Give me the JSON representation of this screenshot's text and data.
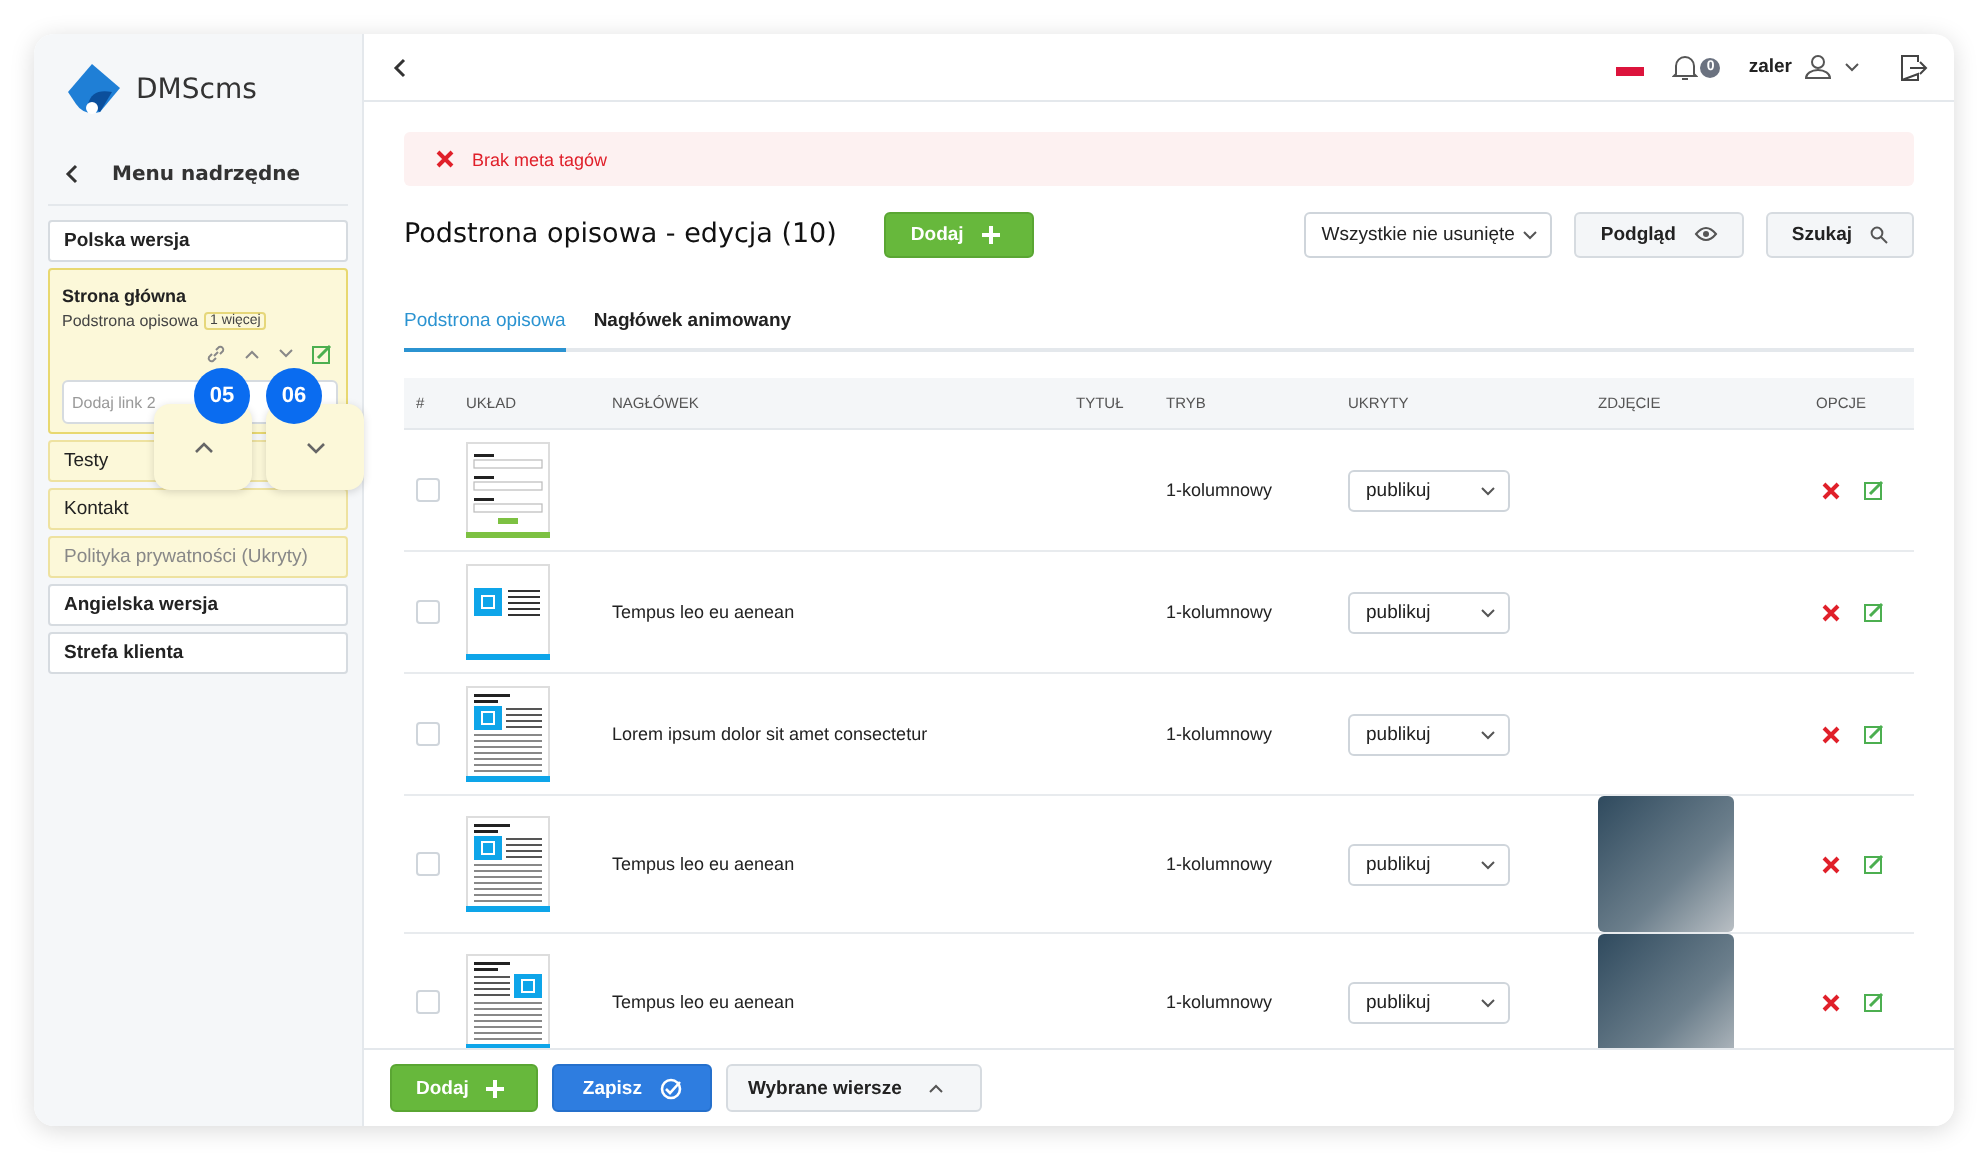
{
  "sidebar": {
    "logo": "DMScms",
    "back_label": "Menu nadrzędne",
    "items": [
      {
        "label": "Polska wersja",
        "children": [
          {
            "label": "Strona główna",
            "expanded": true,
            "hidden": false,
            "subtitle": "Podstrona opisowa",
            "badge": "1 więcej",
            "link_placeholder": "Dodaj link 2"
          },
          {
            "label": "Testy",
            "expanded": false,
            "hidden": false
          },
          {
            "label": "Kontakt",
            "expanded": false,
            "hidden": false
          },
          {
            "label": "Polityka prywatności (Ukryty)",
            "expanded": false,
            "hidden": true
          }
        ]
      },
      {
        "label": "Angielska wersja"
      },
      {
        "label": "Strefa klienta"
      }
    ]
  },
  "callouts": [
    {
      "number": "05",
      "kind": "up"
    },
    {
      "number": "06",
      "kind": "down"
    }
  ],
  "topbar": {
    "notifications": "0",
    "user": "zaler"
  },
  "alert": {
    "text": "Brak meta tagów"
  },
  "header": {
    "title": "Podstrona opisowa - edycja (10)",
    "add_button": "Dodaj",
    "filter": "Wszystkie nie usunięte",
    "preview_button": "Podgląd",
    "search_button": "Szukaj"
  },
  "tabs": [
    {
      "label": "Podstrona opisowa",
      "selected": true
    },
    {
      "label": "Nagłówek animowany",
      "selected": false
    }
  ],
  "table": {
    "columns": [
      "#",
      "UKŁAD",
      "NAGŁÓWEK",
      "TYTUŁ",
      "TRYB",
      "UKRYTY",
      "ZDJĘCIE",
      "OPCJE"
    ],
    "rows": [
      {
        "checked": false,
        "kind": "form",
        "mode": "1-kolumnowy",
        "visibility": "publikuj",
        "photo": false
      },
      {
        "checked": false,
        "kind": "image-left",
        "heading": "Tempus leo eu aenean",
        "mode": "1-kolumnowy",
        "visibility": "publikuj",
        "photo": false
      },
      {
        "checked": false,
        "kind": "text-image",
        "heading": "Lorem ipsum dolor sit amet consectetur",
        "mode": "1-kolumnowy",
        "visibility": "publikuj",
        "photo": false
      },
      {
        "checked": false,
        "kind": "text-image",
        "heading": "Tempus leo eu aenean",
        "mode": "1-kolumnowy",
        "visibility": "publikuj",
        "photo": true
      },
      {
        "checked": false,
        "kind": "image-right",
        "heading": "Tempus leo eu aenean",
        "mode": "1-kolumnowy",
        "visibility": "publikuj",
        "photo": true
      }
    ]
  },
  "footer": {
    "add_button": "Dodaj",
    "save_button": "Zapisz",
    "selected_rows_button": "Wybrane wiersze"
  }
}
